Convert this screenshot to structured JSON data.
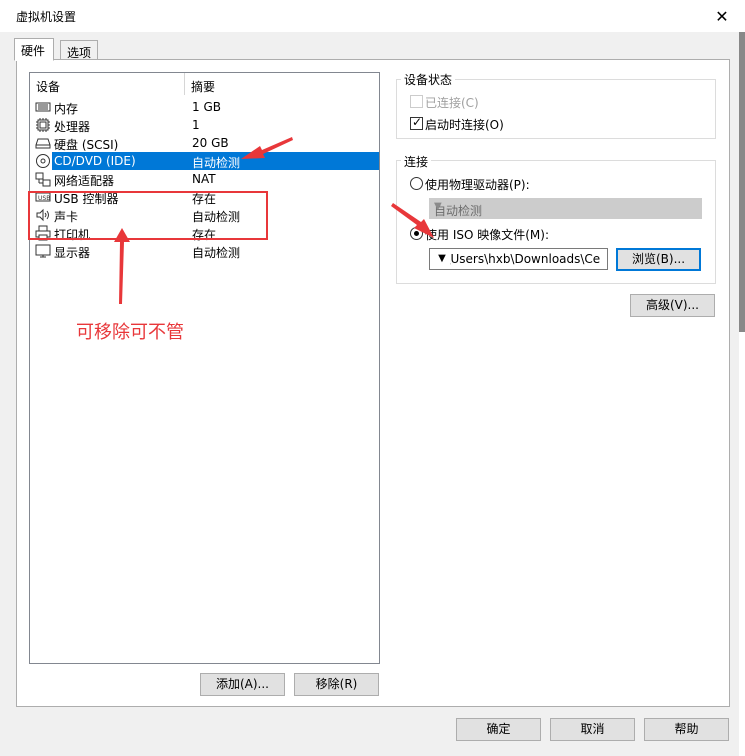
{
  "window": {
    "title": "虚拟机设置",
    "close_glyph": "✕"
  },
  "tabs": [
    {
      "label": "硬件",
      "active": true
    },
    {
      "label": "选项",
      "active": false
    }
  ],
  "device_list": {
    "columns": [
      "设备",
      "摘要"
    ],
    "rows": [
      {
        "name": "内存",
        "summary": "1 GB",
        "icon": "memory-icon"
      },
      {
        "name": "处理器",
        "summary": "1",
        "icon": "cpu-icon"
      },
      {
        "name": "硬盘 (SCSI)",
        "summary": "20 GB",
        "icon": "hard-disk-icon"
      },
      {
        "name": "CD/DVD (IDE)",
        "summary": "自动检测",
        "icon": "cd-dvd-icon",
        "selected": true
      },
      {
        "name": "网络适配器",
        "summary": "NAT",
        "icon": "network-adapter-icon"
      },
      {
        "name": "USB 控制器",
        "summary": "存在",
        "icon": "usb-icon"
      },
      {
        "name": "声卡",
        "summary": "自动检测",
        "icon": "sound-icon"
      },
      {
        "name": "打印机",
        "summary": "存在",
        "icon": "printer-icon"
      },
      {
        "name": "显示器",
        "summary": "自动检测",
        "icon": "display-icon"
      }
    ]
  },
  "list_buttons": {
    "add": "添加(A)...",
    "remove": "移除(R)"
  },
  "device_status": {
    "title": "设备状态",
    "connected": {
      "label": "已连接(C)",
      "checked": false,
      "enabled": false
    },
    "connect_on_power": {
      "label": "启动时连接(O)",
      "checked": true
    }
  },
  "connection": {
    "title": "连接",
    "physical": {
      "label": "使用物理驱动器(P):",
      "selected": false
    },
    "physical_select": "自动检测",
    "iso": {
      "label": "使用 ISO 映像文件(M):",
      "selected": true
    },
    "iso_path": "C:\\Users\\hxb\\Downloads\\Ce",
    "browse": "浏览(B)..."
  },
  "advanced": "高级(V)...",
  "footer": {
    "ok": "确定",
    "cancel": "取消",
    "help": "帮助"
  },
  "annotation": {
    "text": "可移除可不管",
    "color": "#e8373a"
  },
  "colors": {
    "selection": "#0078d7",
    "annotation": "#e8373a"
  }
}
